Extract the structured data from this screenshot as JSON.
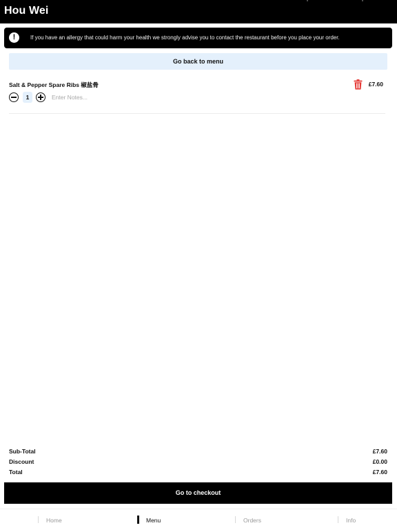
{
  "header": {
    "title": "Hou Wei"
  },
  "allergy_notice": {
    "icon": "exclamation-icon",
    "text": "If you have an allergy that could harm your health we strongly advise you to contact the restaurant before you place your order."
  },
  "back_button": {
    "label": "Go back to menu"
  },
  "cart": {
    "items": [
      {
        "name": "Salt & Pepper Spare Ribs 椒盐骨",
        "price": "£7.60",
        "quantity": "1",
        "notes_placeholder": "Enter Notes...",
        "notes_value": ""
      }
    ]
  },
  "totals": {
    "subtotal_label": "Sub-Total",
    "subtotal_value": "£7.60",
    "discount_label": "Discount",
    "discount_value": "£0.00",
    "total_label": "Total",
    "total_value": "£7.60"
  },
  "checkout_button": {
    "label": "Go to checkout"
  },
  "bottom_nav": {
    "items": [
      {
        "label": "Home",
        "active": false
      },
      {
        "label": "Menu",
        "active": true
      },
      {
        "label": "Orders",
        "active": false
      },
      {
        "label": "Info",
        "active": false
      }
    ]
  },
  "colors": {
    "header_bg": "#000000",
    "light_blue": "#e4f0fc",
    "trash_red": "#e53935"
  }
}
